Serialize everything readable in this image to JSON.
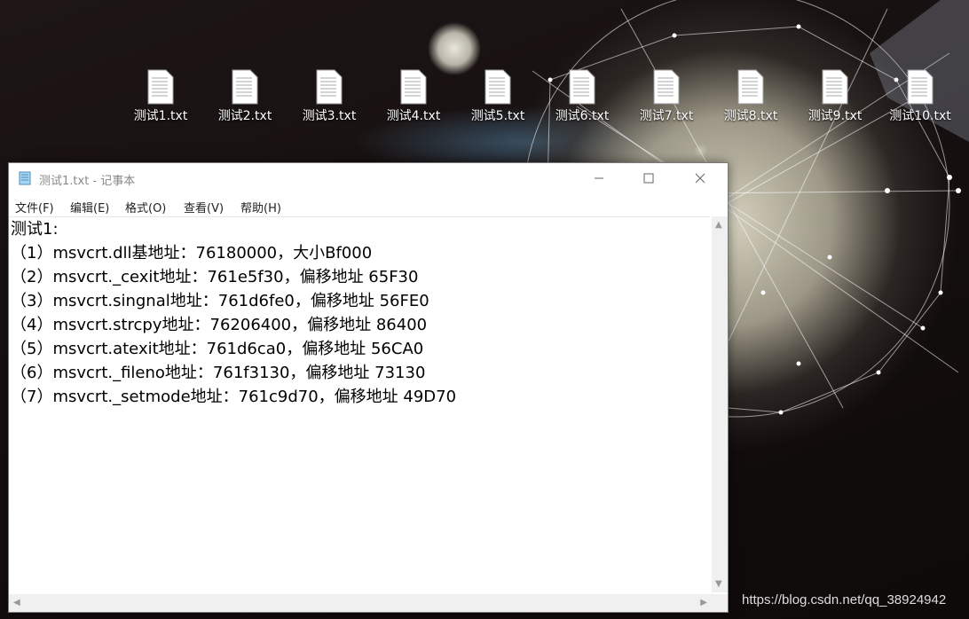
{
  "desktop": {
    "icons": [
      {
        "label": "测试1.txt"
      },
      {
        "label": "测试2.txt"
      },
      {
        "label": "测试3.txt"
      },
      {
        "label": "测试4.txt"
      },
      {
        "label": "测试5.txt"
      },
      {
        "label": "测试6.txt"
      },
      {
        "label": "测试7.txt"
      },
      {
        "label": "测试8.txt"
      },
      {
        "label": "测试9.txt"
      },
      {
        "label": "测试10.txt"
      }
    ],
    "watermark": "https://blog.csdn.net/qq_38924942"
  },
  "notepad": {
    "title": "测试1.txt - 记事本",
    "menu": [
      "文件(F)",
      "编辑(E)",
      "格式(O)",
      "查看(V)",
      "帮助(H)"
    ],
    "lines": [
      "测试1:",
      "（1）msvcrt.dll基地址：76180000，大小Bf000",
      "（2）msvcrt._cexit地址：761e5f30，偏移地址 65F30",
      "（3）msvcrt.singnal地址：761d6fe0，偏移地址 56FE0",
      "（4）msvcrt.strcpy地址：76206400，偏移地址 86400",
      "（5）msvcrt.atexit地址：761d6ca0，偏移地址 56CA0",
      "（6）msvcrt._fileno地址：761f3130，偏移地址 73130",
      "（7）msvcrt._setmode地址：761c9d70，偏移地址 49D70"
    ]
  }
}
